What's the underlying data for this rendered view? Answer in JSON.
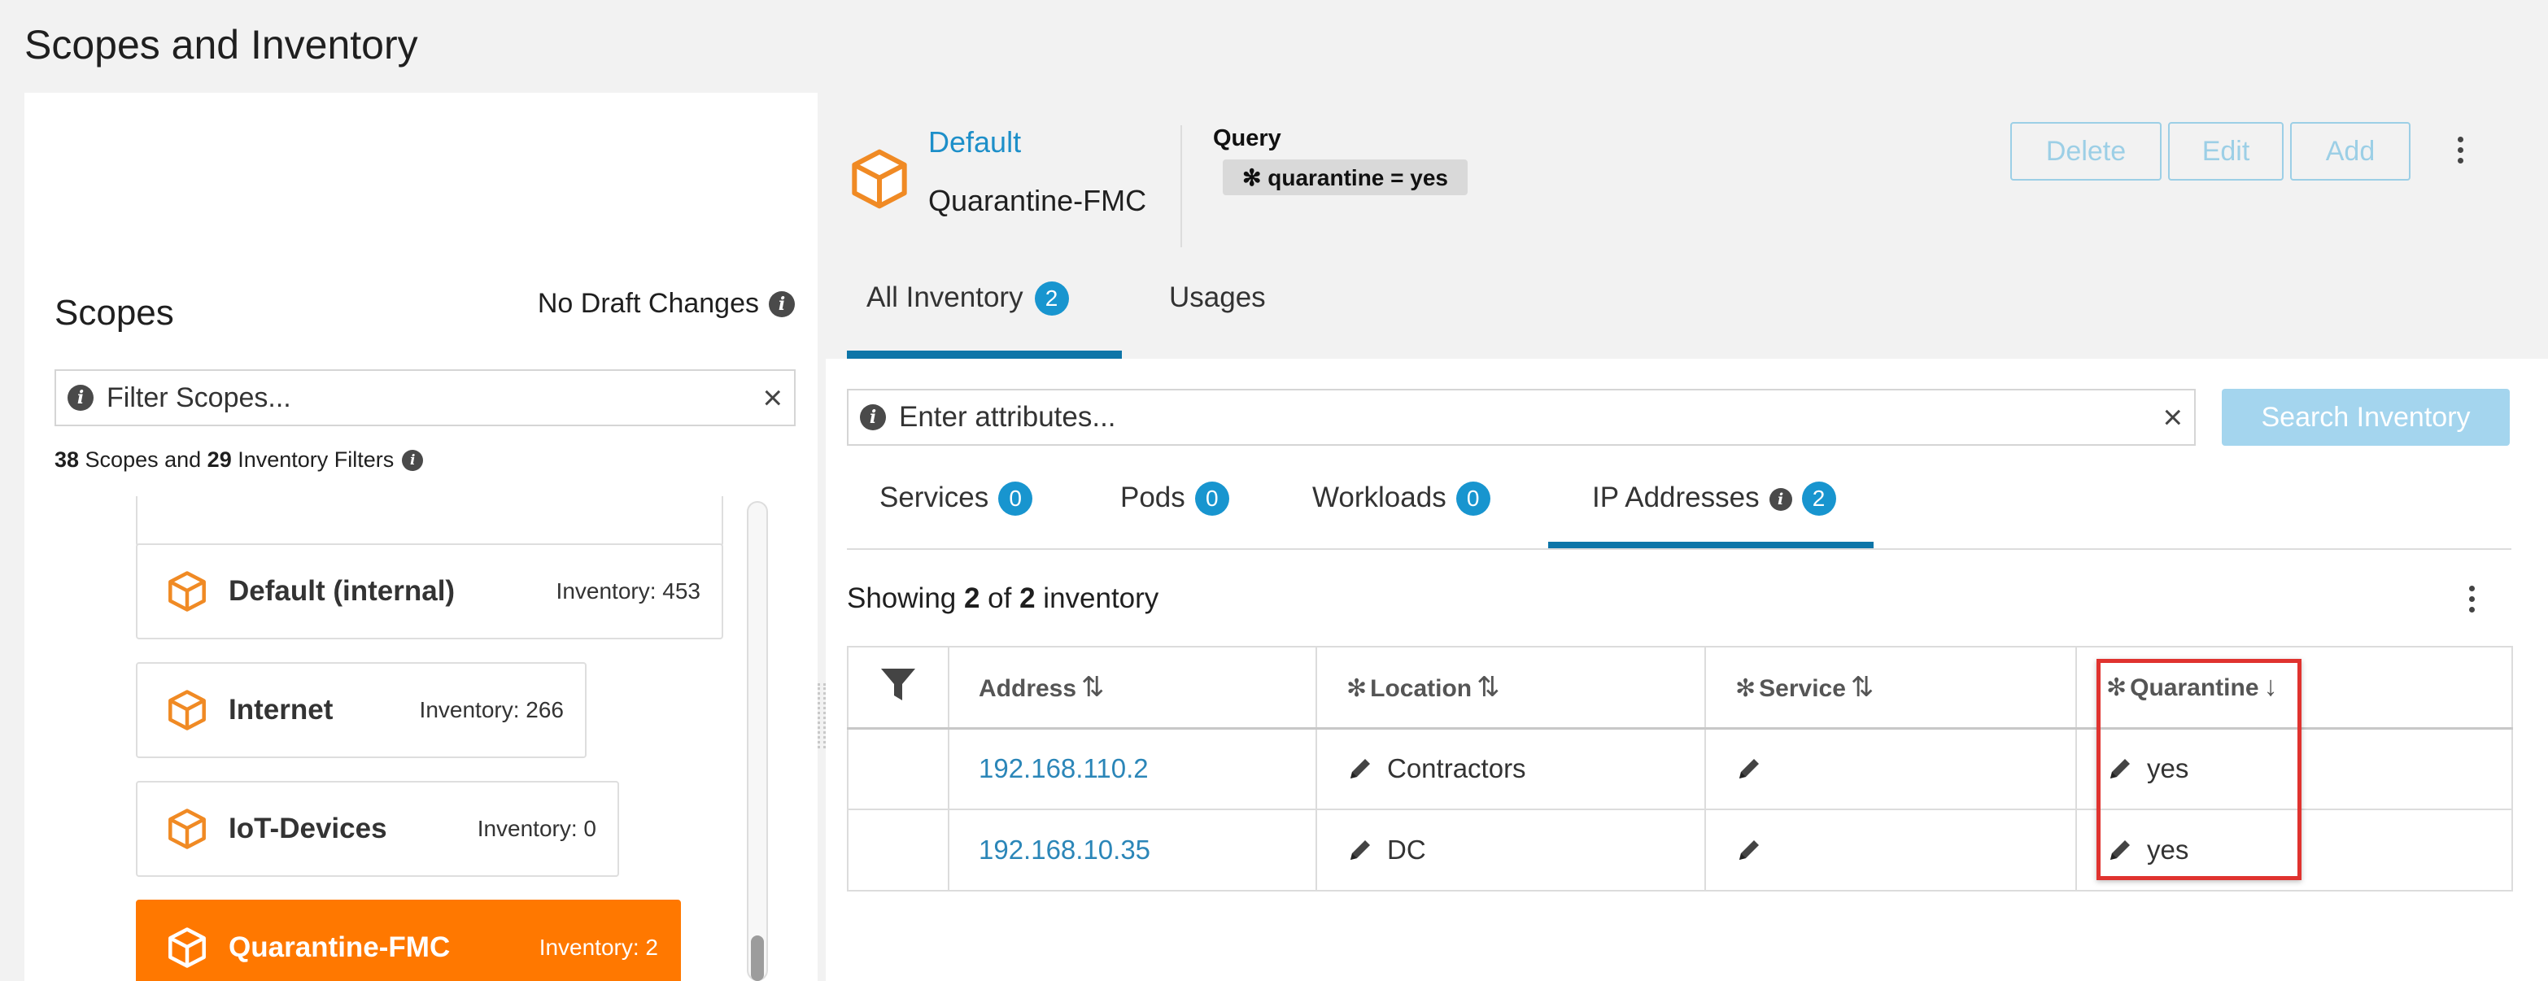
{
  "page": {
    "title": "Scopes and Inventory"
  },
  "scopes_panel": {
    "heading": "Scopes",
    "draft_status": "No Draft Changes",
    "filter_placeholder": "Filter Scopes...",
    "count": {
      "scopes": "38",
      "scopes_label": " Scopes and ",
      "filters": "29",
      "filters_label": " Inventory Filters"
    },
    "items": [
      {
        "name": "Default (internal)",
        "inventory": "Inventory: 453",
        "active": false
      },
      {
        "name": "Internet",
        "inventory": "Inventory: 266",
        "active": false
      },
      {
        "name": "IoT-Devices",
        "inventory": "Inventory: 0",
        "active": false
      },
      {
        "name": "Quarantine-FMC",
        "inventory": "Inventory: 2",
        "active": true
      }
    ]
  },
  "scope_header": {
    "parent": "Default",
    "name": "Quarantine-FMC",
    "query_label": "Query",
    "query_chip": "✻ quarantine = yes",
    "buttons": {
      "delete": "Delete",
      "edit": "Edit",
      "add": "Add"
    }
  },
  "tabs": {
    "all_inventory": {
      "label": "All Inventory",
      "count": "2"
    },
    "usages": {
      "label": "Usages"
    }
  },
  "search": {
    "placeholder": "Enter attributes...",
    "button": "Search Inventory"
  },
  "subtabs": {
    "services": {
      "label": "Services",
      "count": "0"
    },
    "pods": {
      "label": "Pods",
      "count": "0"
    },
    "workloads": {
      "label": "Workloads",
      "count": "0"
    },
    "ip_addresses": {
      "label": "IP Addresses",
      "count": "2"
    }
  },
  "showing": {
    "prefix": "Showing ",
    "shown": "2",
    "mid": " of ",
    "total": "2",
    "suffix": " inventory"
  },
  "table": {
    "columns": {
      "address": "Address",
      "location": "Location",
      "service": "Service",
      "quarantine": "Quarantine"
    },
    "sort": {
      "address": "⇅",
      "location": "⇅",
      "service": "⇅",
      "quarantine": "↓"
    },
    "rows": [
      {
        "address": "192.168.110.2",
        "location": "Contractors",
        "service": "",
        "quarantine": "yes"
      },
      {
        "address": "192.168.10.35",
        "location": "DC",
        "service": "",
        "quarantine": "yes"
      }
    ]
  },
  "colors": {
    "accent_orange": "#ff7800",
    "link_blue": "#1d8fc9",
    "tab_underline": "#0d75a8",
    "badge_blue": "#1895cf",
    "highlight_red": "#e0332f"
  }
}
